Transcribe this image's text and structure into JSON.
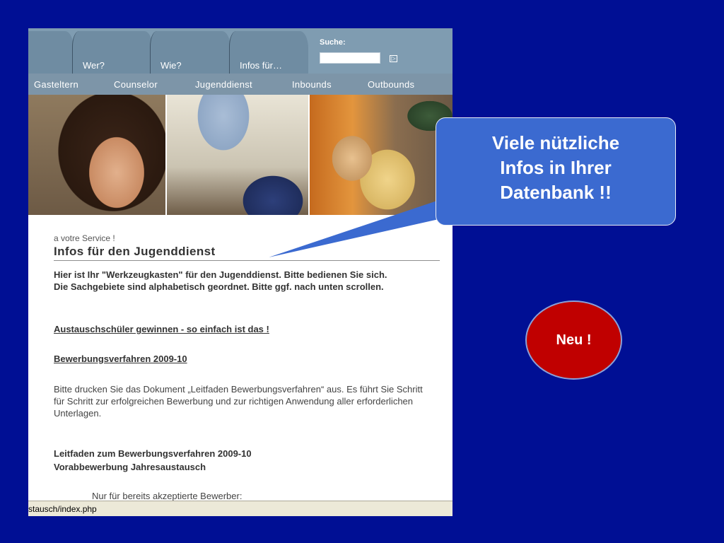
{
  "tabs": [
    {
      "label": ""
    },
    {
      "label": "Wer?"
    },
    {
      "label": "Wie?"
    },
    {
      "label": "Infos für…"
    }
  ],
  "search": {
    "label": "Suche:",
    "value": "",
    "go_glyph": "▷"
  },
  "nav": {
    "items": [
      "Gasteltern",
      "Counselor",
      "Jugenddienst",
      "Inbounds",
      "Outbounds"
    ]
  },
  "content": {
    "kicker": "a votre Service !",
    "heading": "Infos für den Jugenddienst",
    "intro_1": "Hier ist Ihr \"Werkzeugkasten\" für den Jugenddienst. Bitte bedienen Sie sich.",
    "intro_2": "Die Sachgebiete sind alphabetisch geordnet. Bitte ggf. nach unten scrollen.",
    "link_1": "Austauschschüler gewinnen - so einfach ist das !",
    "link_2": "Bewerbungsverfahren 2009-10",
    "paragraph": "Bitte drucken Sie das Dokument „Leitfaden Bewerbungsverfahren“ aus. Es führt Sie Schritt für Schritt zur erfolgreichen Bewerbung und zur richtigen Anwendung aller erforderlichen Unterlagen.",
    "bold_1": "Leitfaden zum Bewerbungsverfahren 2009-10",
    "bold_2": "Vorabbewerbung Jahresaustausch",
    "indent": "Nur für bereits akzeptierte Bewerber:"
  },
  "statusbar": {
    "text": "stausch/index.php"
  },
  "callout": {
    "line1": "Viele nützliche",
    "line2": "Infos in Ihrer",
    "line3": "Datenbank !!"
  },
  "badge": {
    "label": "Neu !"
  },
  "colors": {
    "slide_bg": "#000f94",
    "callout_bg": "#3b6ad0",
    "badge_bg": "#c00000",
    "tab_bg": "#6f8ca2",
    "nav_bg": "#7d95a8"
  }
}
